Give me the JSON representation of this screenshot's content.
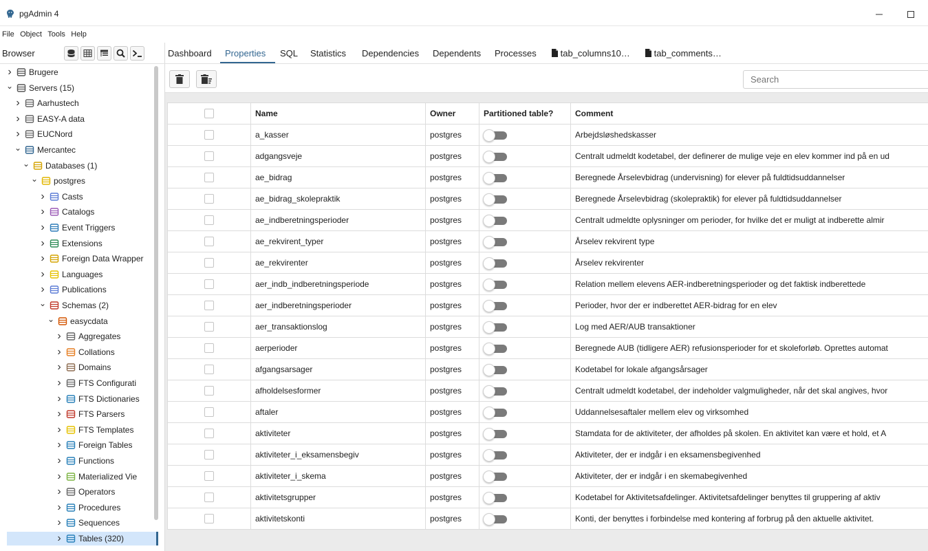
{
  "window": {
    "title": "pgAdmin 4"
  },
  "menu": [
    "File",
    "Object",
    "Tools",
    "Help"
  ],
  "browser": {
    "label": "Browser"
  },
  "tree": [
    {
      "label": "Brugere",
      "depth": 0,
      "expanded": false,
      "icon": "server-group-icon"
    },
    {
      "label": "Servers (15)",
      "depth": 0,
      "expanded": true,
      "icon": "server-group-icon"
    },
    {
      "label": "Aarhustech",
      "depth": 1,
      "expanded": false,
      "icon": "server-disconnected-icon"
    },
    {
      "label": "EASY-A data",
      "depth": 1,
      "expanded": false,
      "icon": "server-disconnected-icon"
    },
    {
      "label": "EUCNord",
      "depth": 1,
      "expanded": false,
      "icon": "server-disconnected-icon"
    },
    {
      "label": "Mercantec",
      "depth": 1,
      "expanded": true,
      "icon": "elephant-icon"
    },
    {
      "label": "Databases (1)",
      "depth": 2,
      "expanded": true,
      "icon": "databases-icon"
    },
    {
      "label": "postgres",
      "depth": 3,
      "expanded": true,
      "icon": "database-icon"
    },
    {
      "label": "Casts",
      "depth": 4,
      "expanded": false,
      "icon": "casts-icon"
    },
    {
      "label": "Catalogs",
      "depth": 4,
      "expanded": false,
      "icon": "catalogs-icon"
    },
    {
      "label": "Event Triggers",
      "depth": 4,
      "expanded": false,
      "icon": "event-triggers-icon"
    },
    {
      "label": "Extensions",
      "depth": 4,
      "expanded": false,
      "icon": "extensions-icon"
    },
    {
      "label": "Foreign Data Wrapper",
      "depth": 4,
      "expanded": false,
      "icon": "foreign-data-wrapper-icon"
    },
    {
      "label": "Languages",
      "depth": 4,
      "expanded": false,
      "icon": "languages-icon"
    },
    {
      "label": "Publications",
      "depth": 4,
      "expanded": false,
      "icon": "publications-icon"
    },
    {
      "label": "Schemas (2)",
      "depth": 4,
      "expanded": true,
      "icon": "schemas-icon"
    },
    {
      "label": "easycdata",
      "depth": 5,
      "expanded": true,
      "icon": "schema-icon"
    },
    {
      "label": "Aggregates",
      "depth": 6,
      "expanded": false,
      "icon": "aggregates-icon"
    },
    {
      "label": "Collations",
      "depth": 6,
      "expanded": false,
      "icon": "collations-icon"
    },
    {
      "label": "Domains",
      "depth": 6,
      "expanded": false,
      "icon": "domains-icon"
    },
    {
      "label": "FTS Configurati",
      "depth": 6,
      "expanded": false,
      "icon": "fts-configuration-icon"
    },
    {
      "label": "FTS Dictionaries",
      "depth": 6,
      "expanded": false,
      "icon": "fts-dictionaries-icon"
    },
    {
      "label": "FTS Parsers",
      "depth": 6,
      "expanded": false,
      "icon": "fts-parsers-icon"
    },
    {
      "label": "FTS Templates",
      "depth": 6,
      "expanded": false,
      "icon": "fts-templates-icon"
    },
    {
      "label": "Foreign Tables",
      "depth": 6,
      "expanded": false,
      "icon": "foreign-tables-icon"
    },
    {
      "label": "Functions",
      "depth": 6,
      "expanded": false,
      "icon": "functions-icon"
    },
    {
      "label": "Materialized Vie",
      "depth": 6,
      "expanded": false,
      "icon": "materialized-views-icon"
    },
    {
      "label": "Operators",
      "depth": 6,
      "expanded": false,
      "icon": "operators-icon"
    },
    {
      "label": "Procedures",
      "depth": 6,
      "expanded": false,
      "icon": "procedures-icon"
    },
    {
      "label": "Sequences",
      "depth": 6,
      "expanded": false,
      "icon": "sequences-icon"
    },
    {
      "label": "Tables (320)",
      "depth": 6,
      "expanded": false,
      "icon": "tables-icon",
      "selected": true
    }
  ],
  "tabs": [
    "Dashboard",
    "Properties",
    "SQL",
    "Statistics",
    "Dependencies",
    "Dependents",
    "Processes",
    "tab_columns10…",
    "tab_comments…"
  ],
  "active_tab": "Properties",
  "search": {
    "placeholder": "Search"
  },
  "columns": [
    "Name",
    "Owner",
    "Partitioned table?",
    "Comment"
  ],
  "rows": [
    {
      "name": "a_kasser",
      "owner": "postgres",
      "partitioned": false,
      "comment": "Arbejdsløshedskasser"
    },
    {
      "name": "adgangsveje",
      "owner": "postgres",
      "partitioned": false,
      "comment": "Centralt udmeldt kodetabel, der definerer de mulige veje en elev kommer ind på en ud"
    },
    {
      "name": "ae_bidrag",
      "owner": "postgres",
      "partitioned": false,
      "comment": "Beregnede Årselevbidrag (undervisning) for elever på fuldtidsuddannelser"
    },
    {
      "name": "ae_bidrag_skolepraktik",
      "owner": "postgres",
      "partitioned": false,
      "comment": "Beregnede Årselevbidrag (skolepraktik) for elever på fuldtidsuddannelser"
    },
    {
      "name": "ae_indberetningsperioder",
      "owner": "postgres",
      "partitioned": false,
      "comment": "Centralt udmeldte oplysninger om perioder, for hvilke det er muligt at indberette almir"
    },
    {
      "name": "ae_rekvirent_typer",
      "owner": "postgres",
      "partitioned": false,
      "comment": "Årselev rekvirent type"
    },
    {
      "name": "ae_rekvirenter",
      "owner": "postgres",
      "partitioned": false,
      "comment": "Årselev rekvirenter"
    },
    {
      "name": "aer_indb_indberetningsperiode",
      "owner": "postgres",
      "partitioned": false,
      "comment": "Relation mellem elevens AER-indberetningsperioder og det faktisk indberettede"
    },
    {
      "name": "aer_indberetningsperioder",
      "owner": "postgres",
      "partitioned": false,
      "comment": "Perioder, hvor der er indberettet AER-bidrag for en elev"
    },
    {
      "name": "aer_transaktionslog",
      "owner": "postgres",
      "partitioned": false,
      "comment": "Log med AER/AUB transaktioner"
    },
    {
      "name": "aerperioder",
      "owner": "postgres",
      "partitioned": false,
      "comment": "Beregnede AUB (tidligere AER) refusionsperioder for et skoleforløb. Oprettes automat"
    },
    {
      "name": "afgangsarsager",
      "owner": "postgres",
      "partitioned": false,
      "comment": "Kodetabel for lokale afgangsårsager"
    },
    {
      "name": "afholdelsesformer",
      "owner": "postgres",
      "partitioned": false,
      "comment": "Centralt udmeldt kodetabel, der indeholder valgmuligheder, når det skal angives, hvor"
    },
    {
      "name": "aftaler",
      "owner": "postgres",
      "partitioned": false,
      "comment": "Uddannelsesaftaler mellem elev og virksomhed"
    },
    {
      "name": "aktiviteter",
      "owner": "postgres",
      "partitioned": false,
      "comment": "Stamdata for de aktiviteter, der afholdes på skolen. En aktivitet kan være et hold, et A"
    },
    {
      "name": "aktiviteter_i_eksamensbegiv",
      "owner": "postgres",
      "partitioned": false,
      "comment": "Aktiviteter, der er indgår i en eksamensbegivenhed"
    },
    {
      "name": "aktiviteter_i_skema",
      "owner": "postgres",
      "partitioned": false,
      "comment": "Aktiviteter, der er indgår i en skemabegivenhed"
    },
    {
      "name": "aktivitetsgrupper",
      "owner": "postgres",
      "partitioned": false,
      "comment": "Kodetabel for Aktivitetsafdelinger. Aktivitetsafdelinger benyttes til gruppering af aktiv"
    },
    {
      "name": "aktivitetskonti",
      "owner": "postgres",
      "partitioned": false,
      "comment": "Konti, der benyttes i forbindelse med kontering af forbrug på den aktuelle aktivitet."
    }
  ],
  "colors": {
    "accent": "#326690",
    "selected_bg": "#d3e6fb"
  }
}
